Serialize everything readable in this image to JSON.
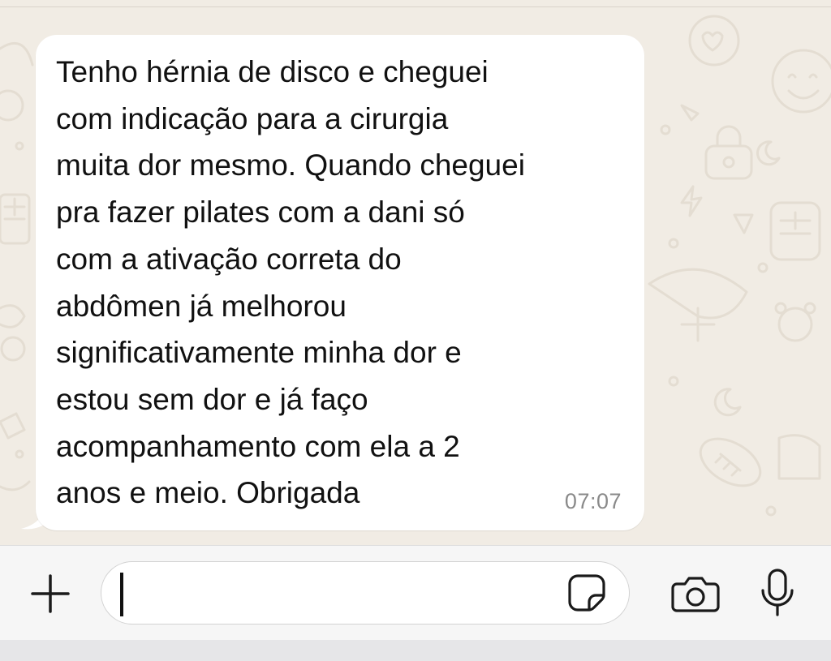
{
  "chat": {
    "message": {
      "text": "Tenho hérnia de disco e cheguei\ncom indicação para a cirurgia\nmuita dor mesmo. Quando cheguei\npra fazer pilates com a dani só\ncom a ativação correta do\nabdômen já melhorou\nsignificativamente minha dor e\nestou sem dor e já faço\nacompanhamento com ela a 2\nanos e meio. Obrigada",
      "time": "07:07"
    }
  },
  "input_bar": {
    "field_value": "",
    "icons": {
      "attach": "plus-icon",
      "sticker": "sticker-icon",
      "camera": "camera-icon",
      "microphone": "microphone-icon"
    }
  },
  "colors": {
    "wallpaper": "#f1ece4",
    "bubble": "#ffffff",
    "text": "#111111",
    "timestamp": "#8a8a8a",
    "input_bar": "#f6f6f6"
  }
}
